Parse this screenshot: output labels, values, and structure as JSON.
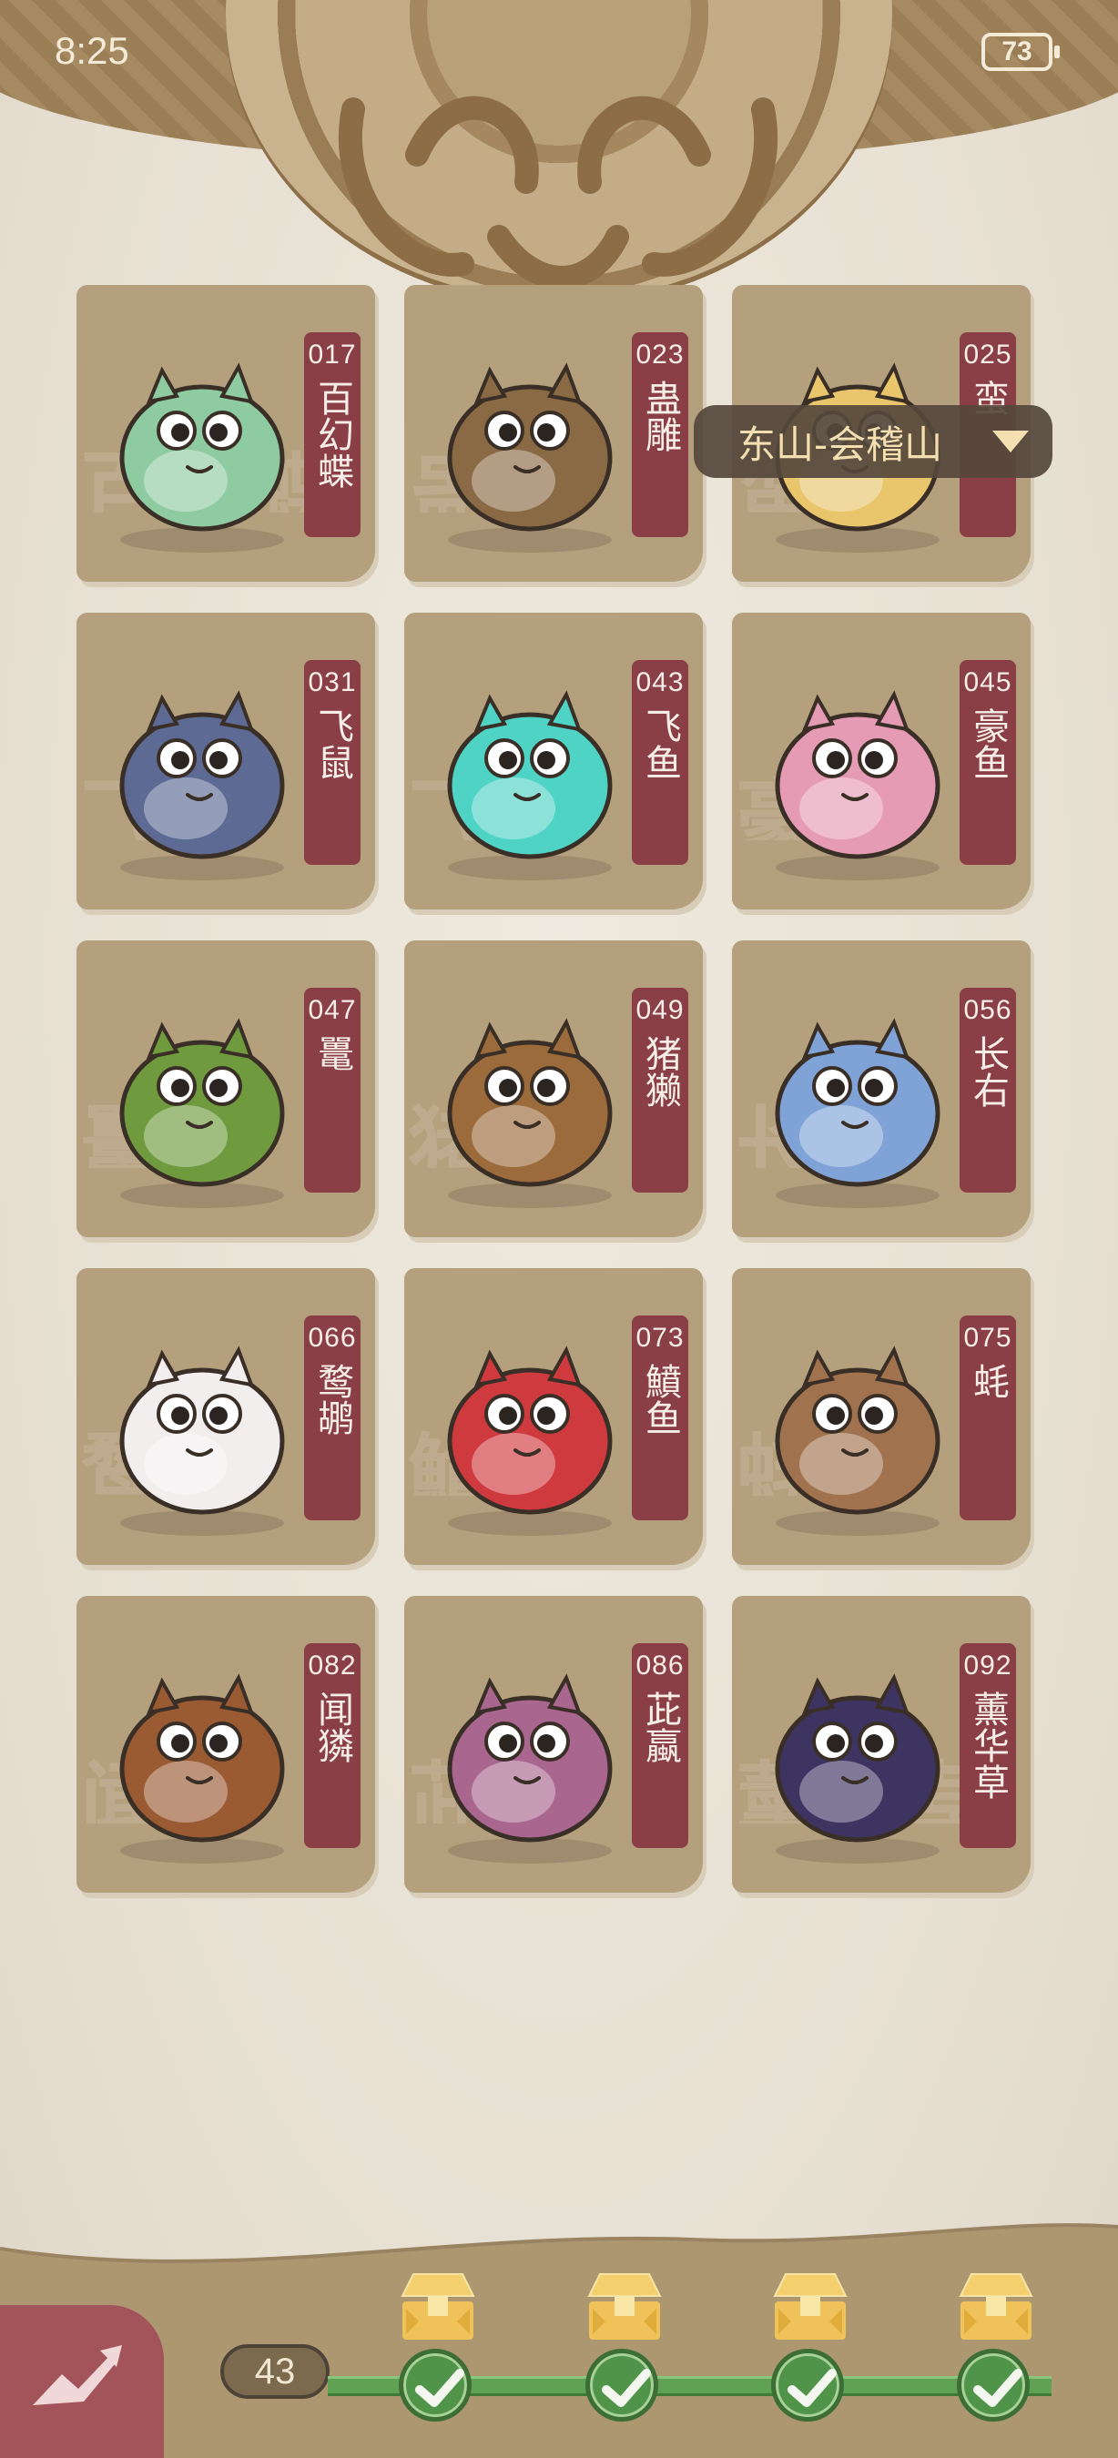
{
  "status_bar": {
    "time": "8:25",
    "battery": "73"
  },
  "region_selector": {
    "label": "东山-会稽山"
  },
  "creatures": [
    {
      "number": "017",
      "name": "百幻蝶",
      "icon": "dragon-larva-creature",
      "color": "#8fcba0"
    },
    {
      "number": "023",
      "name": "蛊雕",
      "icon": "brown-eagle-creature",
      "color": "#8a6a44"
    },
    {
      "number": "025",
      "name": "蛮",
      "icon": "yellow-hamster-creature",
      "color": "#e9c56c"
    },
    {
      "number": "031",
      "name": "飞鼠",
      "icon": "blue-bat-creature",
      "color": "#5d6a93"
    },
    {
      "number": "043",
      "name": "飞鱼",
      "icon": "teal-flying-fish-creature",
      "color": "#4fd3c5"
    },
    {
      "number": "045",
      "name": "豪鱼",
      "icon": "pink-pufferfish-creature",
      "color": "#e59bb4"
    },
    {
      "number": "047",
      "name": "鼍",
      "icon": "green-crocodile-creature",
      "color": "#6f9b3e"
    },
    {
      "number": "049",
      "name": "猪獭",
      "icon": "otter-with-fish-creature",
      "color": "#9b6b3b"
    },
    {
      "number": "056",
      "name": "长右",
      "icon": "blue-monkey-creature",
      "color": "#7fa3d6"
    },
    {
      "number": "066",
      "name": "鹜鹕",
      "icon": "white-pelican-creature",
      "color": "#f2eeee"
    },
    {
      "number": "073",
      "name": "鱝鱼",
      "icon": "red-goldfish-creature",
      "color": "#cf3a3f"
    },
    {
      "number": "075",
      "name": "蚝",
      "icon": "brown-crab-creature",
      "color": "#a0734e"
    },
    {
      "number": "082",
      "name": "闻獜",
      "icon": "brown-boar-creature",
      "color": "#9a5a32"
    },
    {
      "number": "086",
      "name": "茈蠃",
      "icon": "purple-snail-creature",
      "color": "#a9668f"
    },
    {
      "number": "092",
      "name": "薰华草",
      "icon": "eggplant-sprout-creature",
      "color": "#3d3461"
    }
  ],
  "progress": {
    "count": "43",
    "milestones": [
      {
        "icon": "gold-chest-icon",
        "completed": true
      },
      {
        "icon": "gold-chest-icon",
        "completed": true
      },
      {
        "icon": "gold-chest-icon",
        "completed": true
      },
      {
        "icon": "gold-chest-icon",
        "completed": true
      }
    ]
  },
  "back_button": {
    "icon": "back-arrow-icon"
  },
  "colors": {
    "card": "#b5a07e",
    "tag": "#8a3f47",
    "progress_green": "#5fa253",
    "region_bg": "#55483c",
    "region_text": "#f4dfb1"
  }
}
